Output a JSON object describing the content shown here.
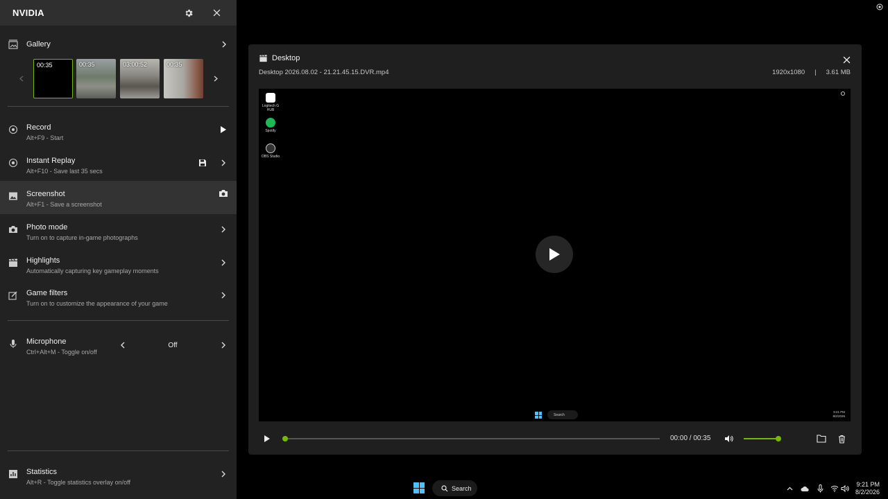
{
  "app": {
    "title": "NVIDIA"
  },
  "gallery": {
    "label": "Gallery",
    "thumbs": [
      {
        "duration": "00:35"
      },
      {
        "duration": "00:35"
      },
      {
        "duration": "03:00:52"
      },
      {
        "duration": "00:35"
      }
    ]
  },
  "items": {
    "record": {
      "title": "Record",
      "sub": "Alt+F9 - Start"
    },
    "replay": {
      "title": "Instant Replay",
      "sub": "Alt+F10 - Save last 35 secs"
    },
    "screenshot": {
      "title": "Screenshot",
      "sub": "Alt+F1 - Save a screenshot"
    },
    "photo": {
      "title": "Photo mode",
      "sub": "Turn on to capture in-game photographs"
    },
    "highlights": {
      "title": "Highlights",
      "sub": "Automatically capturing key gameplay moments"
    },
    "filters": {
      "title": "Game filters",
      "sub": "Turn on to customize the appearance of your game"
    },
    "microphone": {
      "title": "Microphone",
      "sub": "Ctrl+Alt+M - Toggle on/off",
      "value": "Off"
    },
    "statistics": {
      "title": "Statistics",
      "sub": "Alt+R - Toggle statistics overlay on/off"
    }
  },
  "player": {
    "title": "Desktop",
    "filename": "Desktop 2026.08.02 - 21.21.45.15.DVR.mp4",
    "resolution": "1920x1080",
    "separator": "|",
    "size": "3.61 MB",
    "time": "00:00 / 00:35",
    "progress": 0,
    "volume": 1,
    "desktop_icons": [
      "Logitech G HUB",
      "Spotify",
      "OBS Studio"
    ],
    "mini_search": "Search",
    "mini_time": "9:21 PM",
    "mini_date": "8/2/2026"
  },
  "taskbar": {
    "search": "Search",
    "time": "9:21 PM",
    "date": "8/2/2026"
  },
  "colors": {
    "accent": "#76b900",
    "sidebar": "#222222",
    "player": "#1f1f1f"
  }
}
